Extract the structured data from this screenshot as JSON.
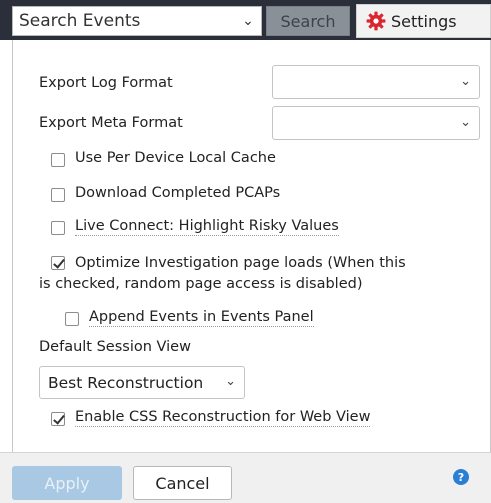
{
  "header": {
    "search_select_value": "Search Events",
    "search_button": "Search",
    "settings_button": "Settings"
  },
  "settings": {
    "export_log_format_label": "Export Log Format",
    "export_log_format_value": "",
    "export_meta_format_label": "Export Meta Format",
    "export_meta_format_value": "",
    "options": [
      {
        "label": "Use Per Device Local Cache",
        "checked": false
      },
      {
        "label": "Download Completed PCAPs",
        "checked": false
      },
      {
        "label": "Live Connect: Highlight Risky Values",
        "checked": false
      },
      {
        "label_line1": "Optimize Investigation page loads (When this",
        "label_line2": "is checked, random page access is disabled)",
        "checked": true
      },
      {
        "label": "Append Events in Events Panel",
        "checked": false
      },
      {
        "label": "Enable CSS Reconstruction for Web View",
        "checked": true
      }
    ],
    "default_session_view_label": "Default Session View",
    "default_session_view_value": "Best Reconstruction"
  },
  "footer": {
    "apply_button": "Apply",
    "cancel_button": "Cancel",
    "help_glyph": "?"
  },
  "colors": {
    "topbar_bg": "#2b2f3a",
    "apply_disabled": "#a9c8e3",
    "gear_red": "#d9262f",
    "help_blue": "#2a7fd4"
  },
  "icons": [
    "chevron-down-icon",
    "gear-icon",
    "help-icon",
    "checkmark-icon"
  ]
}
